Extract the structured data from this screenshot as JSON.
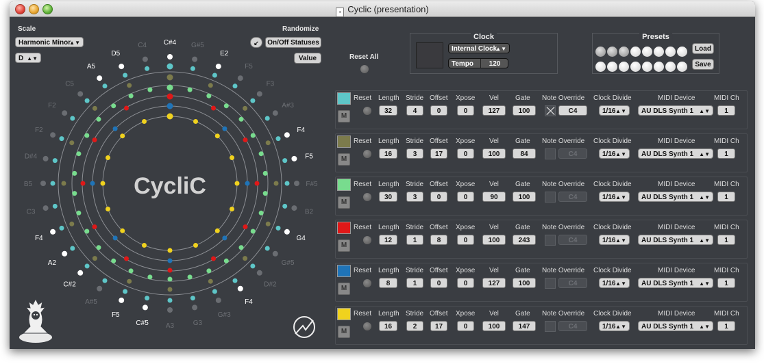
{
  "window": {
    "title": "Cyclic (presentation)"
  },
  "left": {
    "scale_label": "Scale",
    "scale_value": "Harmonic Minor",
    "key_value": "D",
    "randomize_label": "Randomize",
    "randomize_onoff": "On/Off Statuses",
    "randomize_value": "Value",
    "logo_text": "CycliC",
    "outer_notes": [
      {
        "label": "C#4",
        "bright": true
      },
      {
        "label": "G#5",
        "bright": false
      },
      {
        "label": "E2",
        "bright": true
      },
      {
        "label": "F5",
        "bright": false
      },
      {
        "label": "F3",
        "bright": false
      },
      {
        "label": "A#3",
        "bright": false
      },
      {
        "label": "F4",
        "bright": true
      },
      {
        "label": "F5",
        "bright": true
      },
      {
        "label": "F#5",
        "bright": false
      },
      {
        "label": "B2",
        "bright": false
      },
      {
        "label": "G4",
        "bright": true
      },
      {
        "label": "G#5",
        "bright": false
      },
      {
        "label": "D#2",
        "bright": false
      },
      {
        "label": "F4",
        "bright": true
      },
      {
        "label": "G#3",
        "bright": false
      },
      {
        "label": "G3",
        "bright": false
      },
      {
        "label": "A3",
        "bright": false
      },
      {
        "label": "C#5",
        "bright": true
      },
      {
        "label": "F5",
        "bright": true
      },
      {
        "label": "A#5",
        "bright": false
      },
      {
        "label": "C#2",
        "bright": true
      },
      {
        "label": "A2",
        "bright": true
      },
      {
        "label": "F4",
        "bright": true
      },
      {
        "label": "C3",
        "bright": false
      },
      {
        "label": "B5",
        "bright": false
      },
      {
        "label": "D#4",
        "bright": false
      },
      {
        "label": "F2",
        "bright": false
      },
      {
        "label": "F2",
        "bright": false
      },
      {
        "label": "C5",
        "bright": false
      },
      {
        "label": "A5",
        "bright": true
      },
      {
        "label": "D5",
        "bright": true
      },
      {
        "label": "C4",
        "bright": false
      }
    ]
  },
  "reset_all": {
    "label": "Reset All"
  },
  "clock": {
    "title": "Clock",
    "source": "Internal Clock",
    "tempo_label": "Tempo",
    "tempo_value": "120"
  },
  "presets": {
    "title": "Presets",
    "load": "Load",
    "save": "Save",
    "slots": 16
  },
  "columns": {
    "reset": "Reset",
    "length": "Length",
    "stride": "Stride",
    "offset": "Offset",
    "xpose": "Xpose",
    "vel": "Vel",
    "gate": "Gate",
    "note_override": "Note Override",
    "clock_divide": "Clock Divide",
    "midi_device": "MIDI Device",
    "midi_ch": "MIDI Ch"
  },
  "tracks": [
    {
      "color": "#5ec6c8",
      "length": "32",
      "stride": "4",
      "offset": "0",
      "xpose": "0",
      "vel": "127",
      "gate": "100",
      "override_on": true,
      "override_note": "C4",
      "clock_divide": "1/16",
      "midi_device": "AU DLS Synth 1",
      "midi_ch": "1",
      "mute": "M"
    },
    {
      "color": "#7c7b4c",
      "length": "16",
      "stride": "3",
      "offset": "17",
      "xpose": "0",
      "vel": "100",
      "gate": "84",
      "override_on": false,
      "override_note": "C4",
      "clock_divide": "1/16",
      "midi_device": "AU DLS Synth 1",
      "midi_ch": "1",
      "mute": "M"
    },
    {
      "color": "#78dc8e",
      "length": "30",
      "stride": "3",
      "offset": "0",
      "xpose": "0",
      "vel": "90",
      "gate": "100",
      "override_on": false,
      "override_note": "C4",
      "clock_divide": "1/16",
      "midi_device": "AU DLS Synth 1",
      "midi_ch": "1",
      "mute": "M"
    },
    {
      "color": "#e01818",
      "length": "12",
      "stride": "1",
      "offset": "8",
      "xpose": "0",
      "vel": "100",
      "gate": "243",
      "override_on": false,
      "override_note": "C4",
      "clock_divide": "1/16",
      "midi_device": "AU DLS Synth 1",
      "midi_ch": "1",
      "mute": "M"
    },
    {
      "color": "#1f74b8",
      "length": "8",
      "stride": "1",
      "offset": "0",
      "xpose": "0",
      "vel": "127",
      "gate": "100",
      "override_on": false,
      "override_note": "C4",
      "clock_divide": "1/16",
      "midi_device": "AU DLS Synth 1",
      "midi_ch": "1",
      "mute": "M"
    },
    {
      "color": "#f0d21e",
      "length": "16",
      "stride": "2",
      "offset": "17",
      "xpose": "0",
      "vel": "100",
      "gate": "147",
      "override_on": false,
      "override_note": "C4",
      "clock_divide": "1/16",
      "midi_device": "AU DLS Synth 1",
      "midi_ch": "1",
      "mute": "M"
    }
  ]
}
